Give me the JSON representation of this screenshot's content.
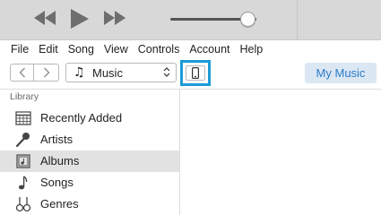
{
  "player": {
    "prev_icon": "rewind-icon",
    "play_icon": "play-icon",
    "next_icon": "fast-forward-icon",
    "volume_level": 0.9
  },
  "menu": [
    "File",
    "Edit",
    "Song",
    "View",
    "Controls",
    "Account",
    "Help"
  ],
  "toolbar": {
    "back_icon": "chevron-left-icon",
    "forward_icon": "chevron-right-icon",
    "library_selector": {
      "icon": "music-note-icon",
      "value": "Music"
    },
    "device_icon": "iphone-icon",
    "my_music_label": "My Music"
  },
  "sidebar": {
    "heading": "Library",
    "items": [
      {
        "label": "Recently Added",
        "icon": "calendar-grid-icon",
        "selected": false
      },
      {
        "label": "Artists",
        "icon": "microphone-icon",
        "selected": false
      },
      {
        "label": "Albums",
        "icon": "album-icon",
        "selected": true
      },
      {
        "label": "Songs",
        "icon": "music-note-icon",
        "selected": false
      },
      {
        "label": "Genres",
        "icon": "instruments-icon",
        "selected": false
      }
    ]
  },
  "colors": {
    "accent": "#1d9bd6",
    "my_music_text": "#2a7bc6",
    "my_music_bg": "#dce7f4",
    "selected_row": "#e2e2e2"
  }
}
